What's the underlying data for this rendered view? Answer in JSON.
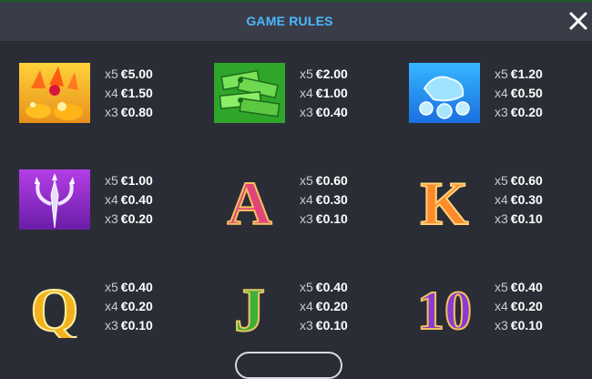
{
  "header": {
    "title": "GAME RULES",
    "close_icon": "close-icon"
  },
  "symbols": [
    {
      "id": "treasure",
      "icon": "gold-treasure-icon",
      "pays": [
        {
          "count": "x5",
          "value": "€5.00"
        },
        {
          "count": "x4",
          "value": "€1.50"
        },
        {
          "count": "x3",
          "value": "€0.80"
        }
      ]
    },
    {
      "id": "cash",
      "icon": "cash-stack-icon",
      "pays": [
        {
          "count": "x5",
          "value": "€2.00"
        },
        {
          "count": "x4",
          "value": "€1.00"
        },
        {
          "count": "x3",
          "value": "€0.40"
        }
      ]
    },
    {
      "id": "gems",
      "icon": "blue-gems-icon",
      "pays": [
        {
          "count": "x5",
          "value": "€1.20"
        },
        {
          "count": "x4",
          "value": "€0.50"
        },
        {
          "count": "x3",
          "value": "€0.20"
        }
      ]
    },
    {
      "id": "trident",
      "icon": "trident-icon",
      "pays": [
        {
          "count": "x5",
          "value": "€1.00"
        },
        {
          "count": "x4",
          "value": "€0.40"
        },
        {
          "count": "x3",
          "value": "€0.20"
        }
      ]
    },
    {
      "id": "a",
      "letter": "A",
      "icon": "letter-a-icon",
      "pays": [
        {
          "count": "x5",
          "value": "€0.60"
        },
        {
          "count": "x4",
          "value": "€0.30"
        },
        {
          "count": "x3",
          "value": "€0.10"
        }
      ]
    },
    {
      "id": "k",
      "letter": "K",
      "icon": "letter-k-icon",
      "pays": [
        {
          "count": "x5",
          "value": "€0.60"
        },
        {
          "count": "x4",
          "value": "€0.30"
        },
        {
          "count": "x3",
          "value": "€0.10"
        }
      ]
    },
    {
      "id": "q",
      "letter": "Q",
      "icon": "letter-q-icon",
      "pays": [
        {
          "count": "x5",
          "value": "€0.40"
        },
        {
          "count": "x4",
          "value": "€0.20"
        },
        {
          "count": "x3",
          "value": "€0.10"
        }
      ]
    },
    {
      "id": "j",
      "letter": "J",
      "icon": "letter-j-icon",
      "pays": [
        {
          "count": "x5",
          "value": "€0.40"
        },
        {
          "count": "x4",
          "value": "€0.20"
        },
        {
          "count": "x3",
          "value": "€0.10"
        }
      ]
    },
    {
      "id": "ten",
      "letter": "10",
      "icon": "number-ten-icon",
      "pays": [
        {
          "count": "x5",
          "value": "€0.40"
        },
        {
          "count": "x4",
          "value": "€0.20"
        },
        {
          "count": "x3",
          "value": "€0.10"
        }
      ]
    }
  ],
  "colors": {
    "background": "#2b2d36",
    "header": "#3a3d48",
    "title": "#4db8ff",
    "a": "#e0457a",
    "k": "#ff8a2a",
    "q": "#f2b21e",
    "j": "#3fae3a",
    "ten": "#8a3bd1"
  }
}
